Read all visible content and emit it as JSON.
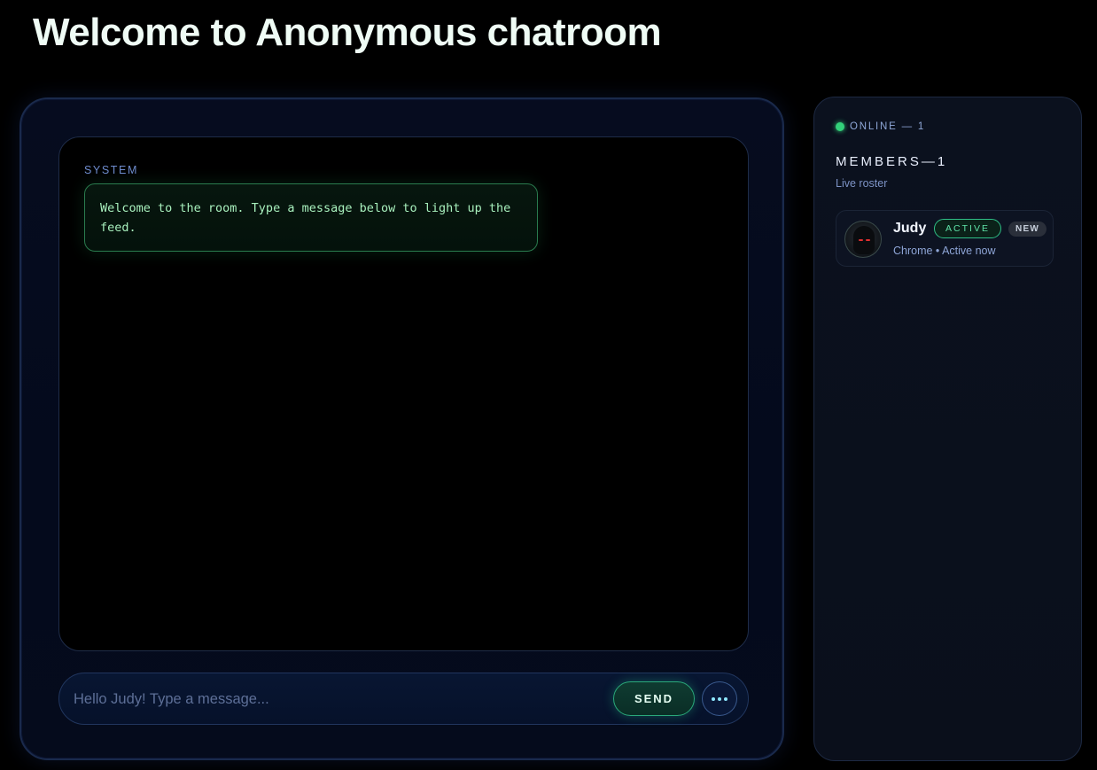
{
  "page": {
    "title": "Welcome to Anonymous chatroom"
  },
  "chat": {
    "messages": [
      {
        "sender": "SYSTEM",
        "text": "Welcome to the room. Type a message below to light up the feed."
      }
    ],
    "composer": {
      "placeholder": "Hello Judy! Type a message...",
      "value": "",
      "send_label": "SEND",
      "more_icon": "more-horizontal-icon"
    }
  },
  "roster": {
    "online_label": "ONLINE — 1",
    "title": "MEMBERS—1",
    "subtitle": "Live roster",
    "members": [
      {
        "name": "Judy",
        "status_badge": "ACTIVE",
        "new_badge": "NEW",
        "meta": "Chrome • Active now",
        "avatar_icon": "hooded-figure-avatar"
      }
    ]
  },
  "colors": {
    "accent_green": "#33d17a",
    "online_dot": "#33d17a",
    "bubble_border": "#2a7b4e"
  }
}
